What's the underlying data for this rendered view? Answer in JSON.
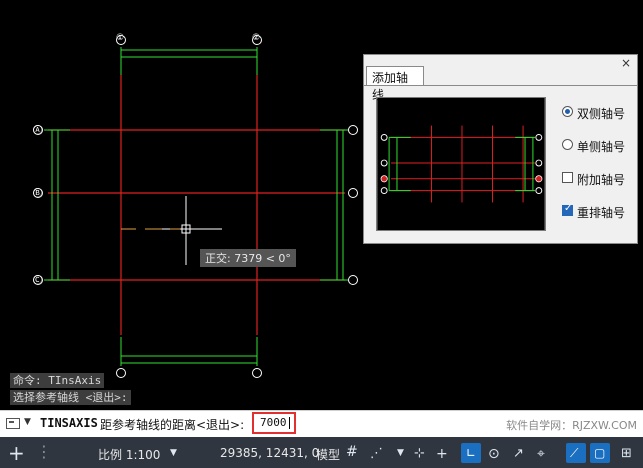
{
  "colors": {
    "grid_red": "#e02020",
    "dim_green": "#30e030",
    "background": "#000000",
    "accent": "#1b6fc0"
  },
  "axes": {
    "top_labels": [
      "①",
      "②"
    ],
    "side_labels": [
      "Ⓐ",
      "Ⓑ",
      "Ⓒ"
    ]
  },
  "tooltip": {
    "text": "正交: 7379 < 0°"
  },
  "command_history": [
    "命令: TInsAxis",
    "选择参考轴线 <退出>:"
  ],
  "command_line": {
    "command": "TINSAXIS",
    "prompt": "距参考轴线的距离<退出>:",
    "value": "7000",
    "watermark": "软件自学网：RJZXW.COM"
  },
  "panel": {
    "title": "添加轴线",
    "close": "×",
    "options": [
      {
        "label": "双侧轴号",
        "kind": "radio",
        "checked": true
      },
      {
        "label": "单侧轴号",
        "kind": "radio",
        "checked": false
      },
      {
        "label": "附加轴号",
        "kind": "check",
        "checked": false
      },
      {
        "label": "重排轴号",
        "kind": "check",
        "checked": true
      }
    ]
  },
  "status": {
    "scale": "比例 1:100",
    "coords": "29385, 12431, 0",
    "model": "模型"
  },
  "icons": {
    "plus": "plus-icon",
    "grid": "grid-icon",
    "snap": "snap-icon"
  }
}
